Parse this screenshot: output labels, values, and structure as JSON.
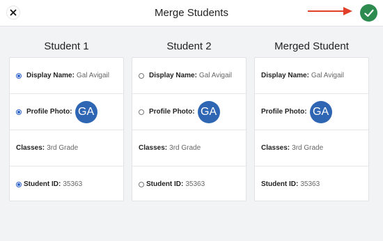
{
  "header": {
    "title": "Merge Students"
  },
  "columns": [
    {
      "title": "Student 1",
      "display_label": "Display Name:",
      "display_value": "Gal Avigail",
      "photo_label": "Profile Photo:",
      "avatar_initials": "GA",
      "classes_label": "Classes:",
      "classes_value": "3rd Grade",
      "id_label": "Student ID:",
      "id_value": "35363",
      "selected": {
        "display": true,
        "photo": true,
        "id": true
      }
    },
    {
      "title": "Student 2",
      "display_label": "Display Name:",
      "display_value": "Gal Avigail",
      "photo_label": "Profile Photo:",
      "avatar_initials": "GA",
      "classes_label": "Classes:",
      "classes_value": "3rd Grade",
      "id_label": "Student ID:",
      "id_value": "35363",
      "selected": {
        "display": false,
        "photo": false,
        "id": false
      }
    },
    {
      "title": "Merged Student",
      "display_label": "Display Name:",
      "display_value": "Gal Avigail",
      "photo_label": "Profile Photo:",
      "avatar_initials": "GA",
      "classes_label": "Classes:",
      "classes_value": "3rd Grade",
      "id_label": "Student ID:",
      "id_value": "35363"
    }
  ],
  "colors": {
    "accent": "#2a62c8",
    "confirm": "#2e8b4f",
    "arrow": "#e0402a",
    "avatar": "#2f66b4"
  }
}
